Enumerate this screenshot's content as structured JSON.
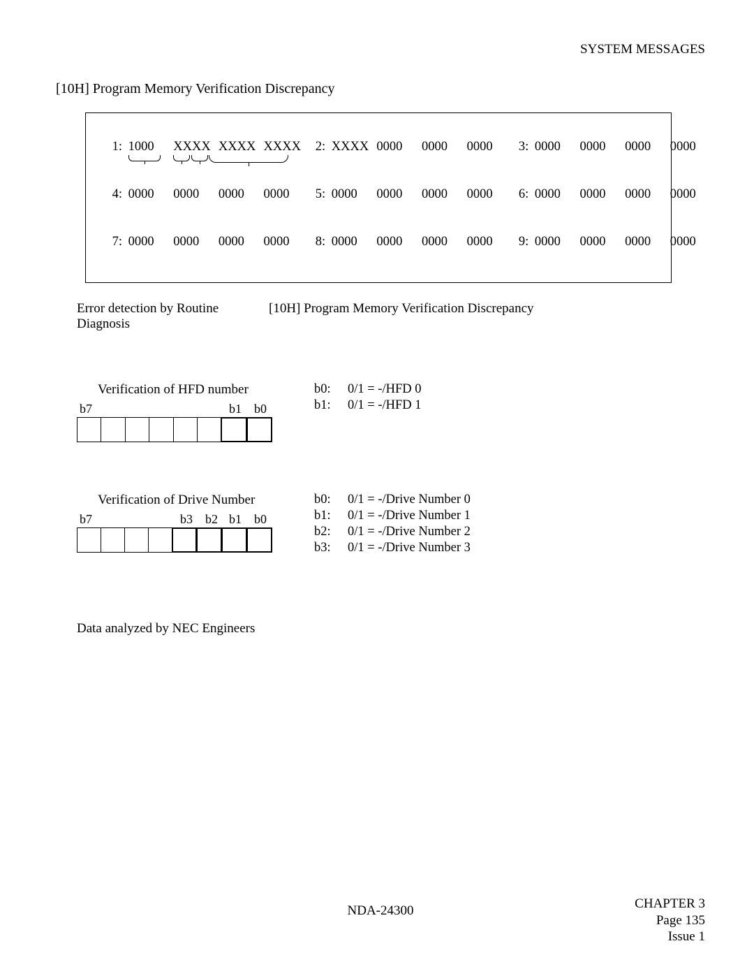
{
  "header": {
    "right": "SYSTEM MESSAGES"
  },
  "title": "[10H] Program Memory Verification Discrepancy",
  "datalines": {
    "r1": {
      "g1": {
        "label": "1:",
        "w": [
          "1000",
          "XXXX",
          "XXXX",
          "XXXX"
        ]
      },
      "g2": {
        "label": "2:",
        "w": [
          "XXXX",
          "0000",
          "0000",
          "0000"
        ]
      },
      "g3": {
        "label": "3:",
        "w": [
          "0000",
          "0000",
          "0000",
          "0000"
        ]
      }
    },
    "r2": {
      "g1": {
        "label": "4:",
        "w": [
          "0000",
          "0000",
          "0000",
          "0000"
        ]
      },
      "g2": {
        "label": "5:",
        "w": [
          "0000",
          "0000",
          "0000",
          "0000"
        ]
      },
      "g3": {
        "label": "6:",
        "w": [
          "0000",
          "0000",
          "0000",
          "0000"
        ]
      }
    },
    "r3": {
      "g1": {
        "label": "7:",
        "w": [
          "0000",
          "0000",
          "0000",
          "0000"
        ]
      },
      "g2": {
        "label": "8:",
        "w": [
          "0000",
          "0000",
          "0000",
          "0000"
        ]
      },
      "g3": {
        "label": "9:",
        "w": [
          "0000",
          "0000",
          "0000",
          "0000"
        ]
      }
    }
  },
  "errline": {
    "left1": "Error detection by Routine",
    "left2": "Diagnosis",
    "right": "[10H] Program Memory Verification Discrepancy"
  },
  "hfd": {
    "title": "Verification of HFD number",
    "labels": {
      "b7": "b7",
      "b1": "b1",
      "b0": "b0"
    },
    "desc": [
      {
        "k": "b0:",
        "v": "0/1 = -/HFD 0"
      },
      {
        "k": "b1:",
        "v": "0/1 = -/HFD 1"
      }
    ]
  },
  "drive": {
    "title": "Verification of Drive Number",
    "labels": {
      "b7": "b7",
      "b3": "b3",
      "b2": "b2",
      "b1": "b1",
      "b0": "b0"
    },
    "desc": [
      {
        "k": "b0:",
        "v": "0/1 = -/Drive Number 0"
      },
      {
        "k": "b1:",
        "v": "0/1 = -/Drive Number 1"
      },
      {
        "k": "b2:",
        "v": "0/1 = -/Drive Number 2"
      },
      {
        "k": "b3:",
        "v": "0/1 = -/Drive Number 3"
      }
    ]
  },
  "note": "Data analyzed by NEC Engineers",
  "footer": {
    "center": "NDA-24300",
    "chapter": "CHAPTER 3",
    "page": "Page 135",
    "issue": "Issue 1"
  }
}
